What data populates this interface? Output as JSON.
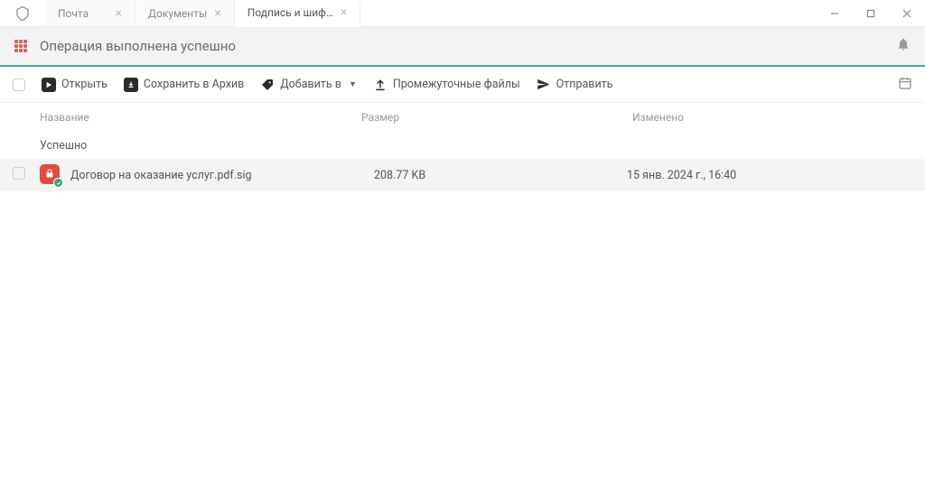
{
  "tabs": [
    {
      "label": "Почта"
    },
    {
      "label": "Документы"
    },
    {
      "label": "Подпись и шиф…"
    }
  ],
  "header": {
    "title": "Операция выполнена успешно"
  },
  "toolbar": {
    "open": "Открыть",
    "save_archive": "Сохранить в Архив",
    "add_to": "Добавить в",
    "intermediate": "Промежуточные файлы",
    "send": "Отправить"
  },
  "columns": {
    "name": "Название",
    "size": "Размер",
    "modified": "Изменено"
  },
  "group": {
    "label": "Успешно"
  },
  "files": [
    {
      "name": "Договор на оказание услуг.pdf.sig",
      "size": "208.77 KB",
      "modified": "15 янв. 2024 г., 16:40"
    }
  ]
}
